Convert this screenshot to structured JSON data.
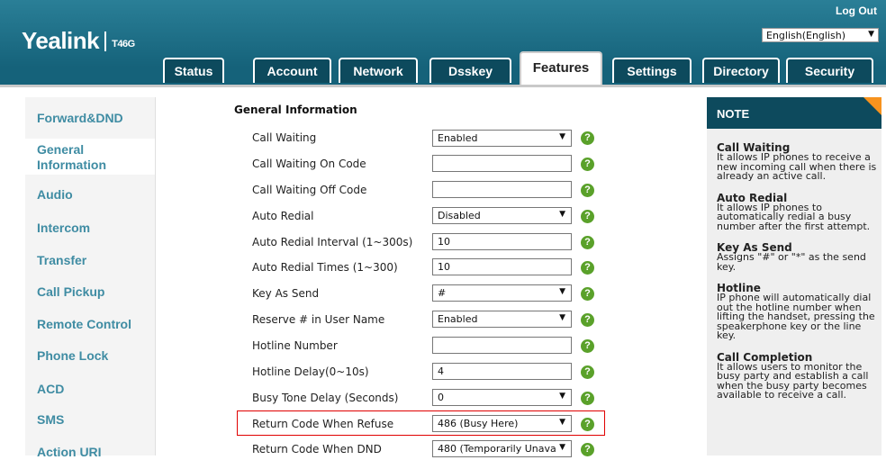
{
  "header": {
    "brand": "Yealink",
    "model": "T46G",
    "logout": "Log Out",
    "language": "English(English)"
  },
  "tabs": [
    {
      "label": "Status"
    },
    {
      "label": "Account"
    },
    {
      "label": "Network"
    },
    {
      "label": "Dsskey"
    },
    {
      "label": "Features"
    },
    {
      "label": "Settings"
    },
    {
      "label": "Directory"
    },
    {
      "label": "Security"
    }
  ],
  "sidebar": {
    "items": [
      {
        "label": "Forward&DND"
      },
      {
        "label": "General Information"
      },
      {
        "label": "Audio"
      },
      {
        "label": "Intercom"
      },
      {
        "label": "Transfer"
      },
      {
        "label": "Call Pickup"
      },
      {
        "label": "Remote Control"
      },
      {
        "label": "Phone Lock"
      },
      {
        "label": "ACD"
      },
      {
        "label": "SMS"
      },
      {
        "label": "Action URI"
      }
    ]
  },
  "main": {
    "section_title": "General Information",
    "rows": [
      {
        "label": "Call Waiting",
        "value": "Enabled"
      },
      {
        "label": "Call Waiting On Code",
        "value": ""
      },
      {
        "label": "Call Waiting Off Code",
        "value": ""
      },
      {
        "label": "Auto Redial",
        "value": "Disabled"
      },
      {
        "label": "Auto Redial Interval (1~300s)",
        "value": "10"
      },
      {
        "label": "Auto Redial Times (1~300)",
        "value": "10"
      },
      {
        "label": "Key As Send",
        "value": "#"
      },
      {
        "label": "Reserve # in User Name",
        "value": "Enabled"
      },
      {
        "label": "Hotline Number",
        "value": ""
      },
      {
        "label": "Hotline Delay(0~10s)",
        "value": "4"
      },
      {
        "label": "Busy Tone Delay (Seconds)",
        "value": "0"
      },
      {
        "label": "Return Code When Refuse",
        "value": "486 (Busy Here)"
      },
      {
        "label": "Return Code When DND",
        "value": "480 (Temporarily Unava"
      }
    ],
    "help_glyph": "?"
  },
  "note": {
    "title": "NOTE",
    "items": [
      {
        "title": "Call Waiting",
        "text": "It allows IP phones to receive a new incoming call when there is already an active call."
      },
      {
        "title": "Auto Redial",
        "text": "It allows IP phones to automatically redial a busy number after the first attempt."
      },
      {
        "title": "Key As Send",
        "text": "Assigns \"#\" or \"*\" as the send key."
      },
      {
        "title": "Hotline",
        "text": "IP phone will automatically dial out the hotline number when lifting the handset, pressing the speakerphone key or the line key."
      },
      {
        "title": "Call Completion",
        "text": "It allows users to monitor the busy party and establish a call when the busy party becomes available to receive a call."
      }
    ]
  },
  "colors": {
    "header": "#1d6f86",
    "tab": "#0d4a5d",
    "sidebar_link": "#3f8ca3",
    "help": "#5aa12a",
    "highlight": "#e00000",
    "note_accent": "#f7931e"
  }
}
